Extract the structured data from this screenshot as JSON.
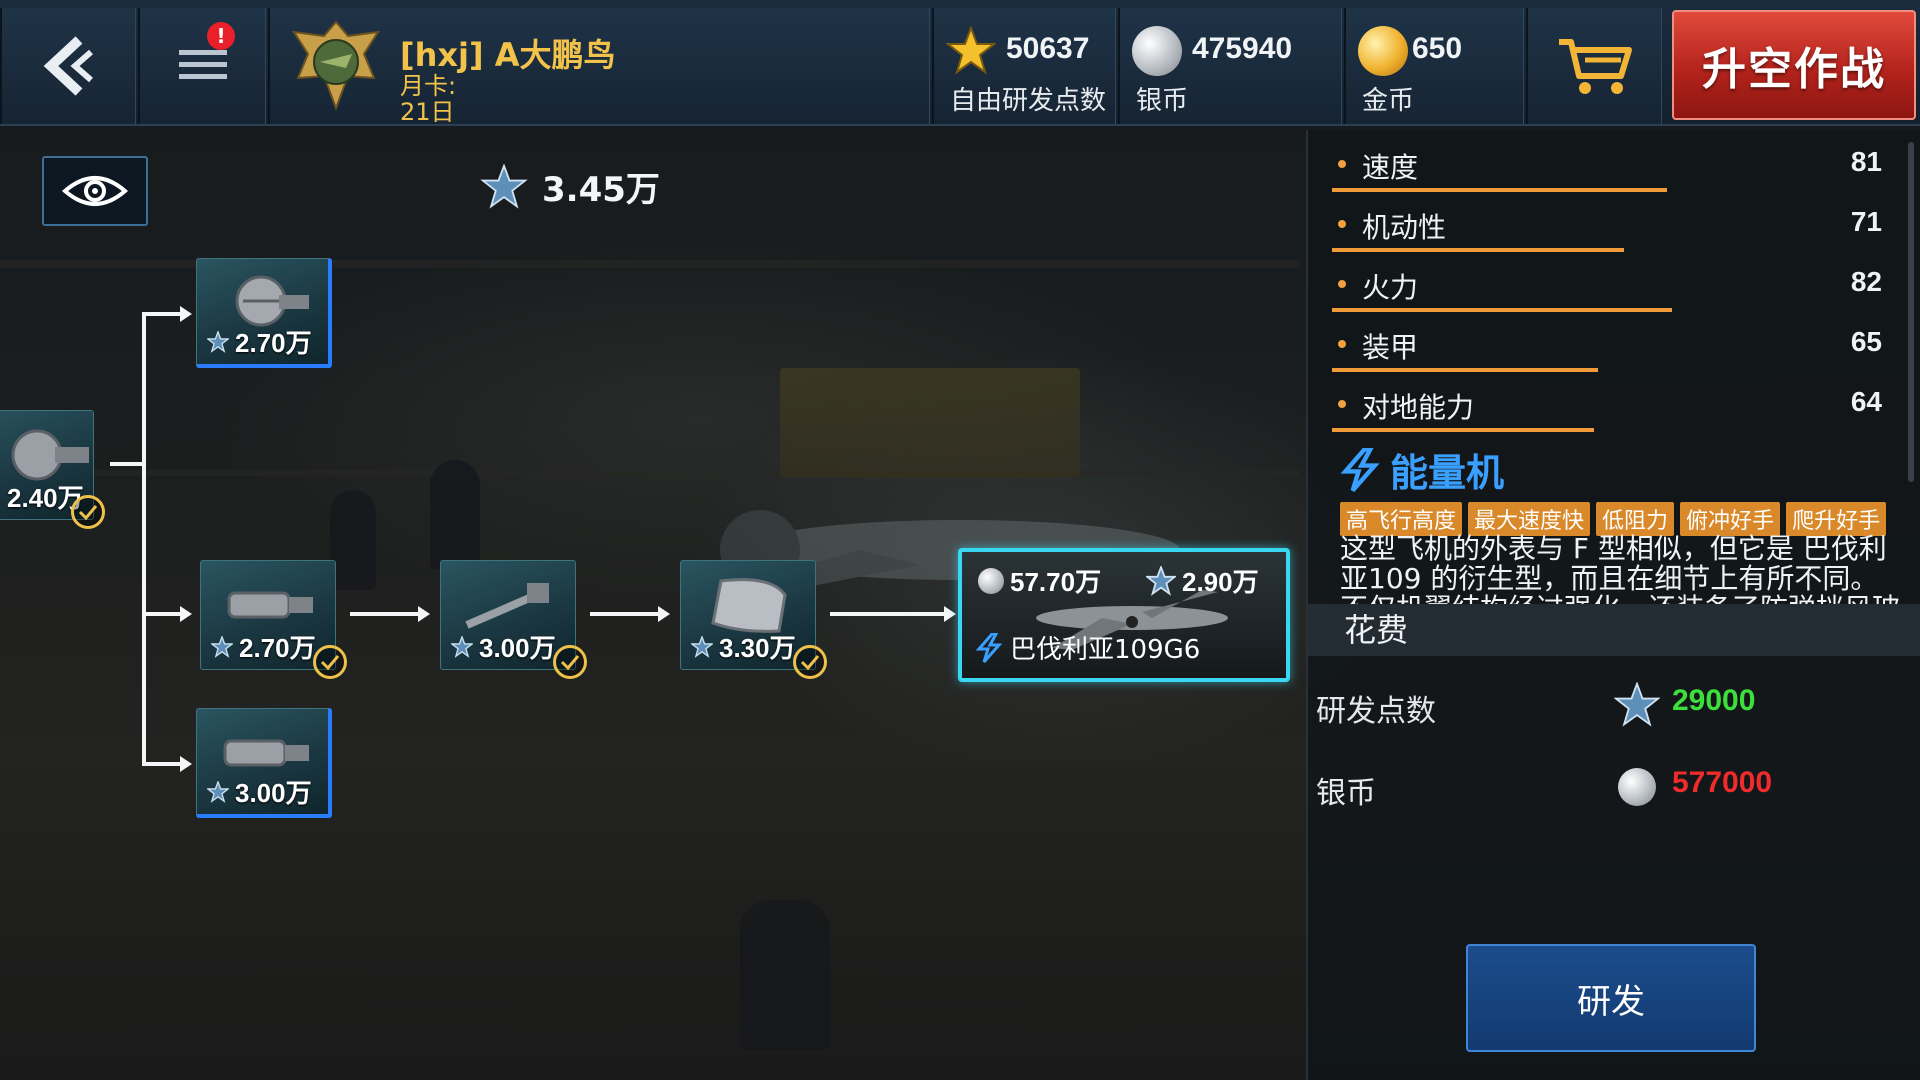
{
  "topbar": {
    "player_name": "[hxj] A大鹏鸟",
    "card_label": "月卡:",
    "card_value": "21日",
    "free_research_points": "50637",
    "free_research_label": "自由研发点数",
    "silver": "475940",
    "silver_label": "银币",
    "gold": "650",
    "gold_label": "金币",
    "launch_label": "升空作战",
    "notification_badge": "!"
  },
  "tree": {
    "total_points": "3.45万",
    "nodes": {
      "root": "2.40万",
      "top": "2.70万",
      "mid_1": "2.70万",
      "mid_2": "3.00万",
      "mid_3": "3.30万",
      "bottom": "3.00万"
    },
    "plane": {
      "silver_cost": "57.70万",
      "point_cost": "2.90万",
      "name": "巴伐利亚109G6"
    }
  },
  "panel": {
    "stats": [
      {
        "name": "速度",
        "value": "81"
      },
      {
        "name": "机动性",
        "value": "71"
      },
      {
        "name": "火力",
        "value": "82"
      },
      {
        "name": "装甲",
        "value": "65"
      },
      {
        "name": "对地能力",
        "value": "64"
      }
    ],
    "type_label": "能量机",
    "tags": [
      "高飞行高度",
      "最大速度快",
      "低阻力",
      "俯冲好手",
      "爬升好手"
    ],
    "description": "这型飞机的外表与 F 型相似，但它是 巴伐利亚109 的衍生型，而且在细节上有所不同。不仅机翼结构经过强化，还装备了防弹挡风玻",
    "cost_header": "花费",
    "cost_points_label": "研发点数",
    "cost_points_value": "29000",
    "cost_silver_label": "银币",
    "cost_silver_value": "577000",
    "research_label": "研发"
  },
  "colors": {
    "accent_blue": "#39d7f2",
    "points_green": "#3de03a",
    "silver_red": "#ef2b2b",
    "stat_bar": "#f09a3a",
    "gold_text": "#f2c24a"
  }
}
